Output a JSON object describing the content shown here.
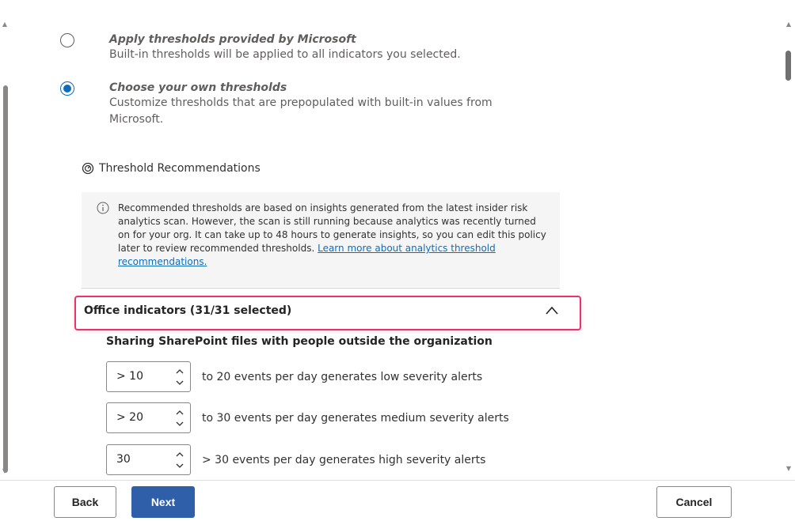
{
  "options": [
    {
      "title": "Apply thresholds provided by Microsoft",
      "desc": "Built-in thresholds will be applied to all indicators you selected.",
      "checked": false
    },
    {
      "title": "Choose your own thresholds",
      "desc": "Customize thresholds that are prepopulated with built-in values from Microsoft.",
      "checked": true
    }
  ],
  "recommendations": {
    "heading": "Threshold Recommendations",
    "info_text": "Recommended thresholds are based on insights generated from the latest insider risk analytics scan. However, the scan is still running because analytics was recently turned on for your org. It can take up to 48 hours to generate insights, so you can edit this policy later to review recommended thresholds.",
    "link_text": "Learn more about analytics threshold recommendations."
  },
  "accordion": {
    "title": "Office indicators (31/31 selected)"
  },
  "section": {
    "title": "Sharing SharePoint files with people outside the organization",
    "rows": [
      {
        "value": "> 10",
        "text": "to 20 events per day generates low severity alerts"
      },
      {
        "value": "> 20",
        "text": "to 30 events per day generates medium severity alerts"
      },
      {
        "value": "30",
        "text": "> 30 events per day generates high severity alerts"
      }
    ]
  },
  "footer": {
    "back": "Back",
    "next": "Next",
    "cancel": "Cancel"
  },
  "colors": {
    "accent": "#0f6cbd",
    "primary_button": "#2f5fa8",
    "highlight": "#e8336b"
  }
}
